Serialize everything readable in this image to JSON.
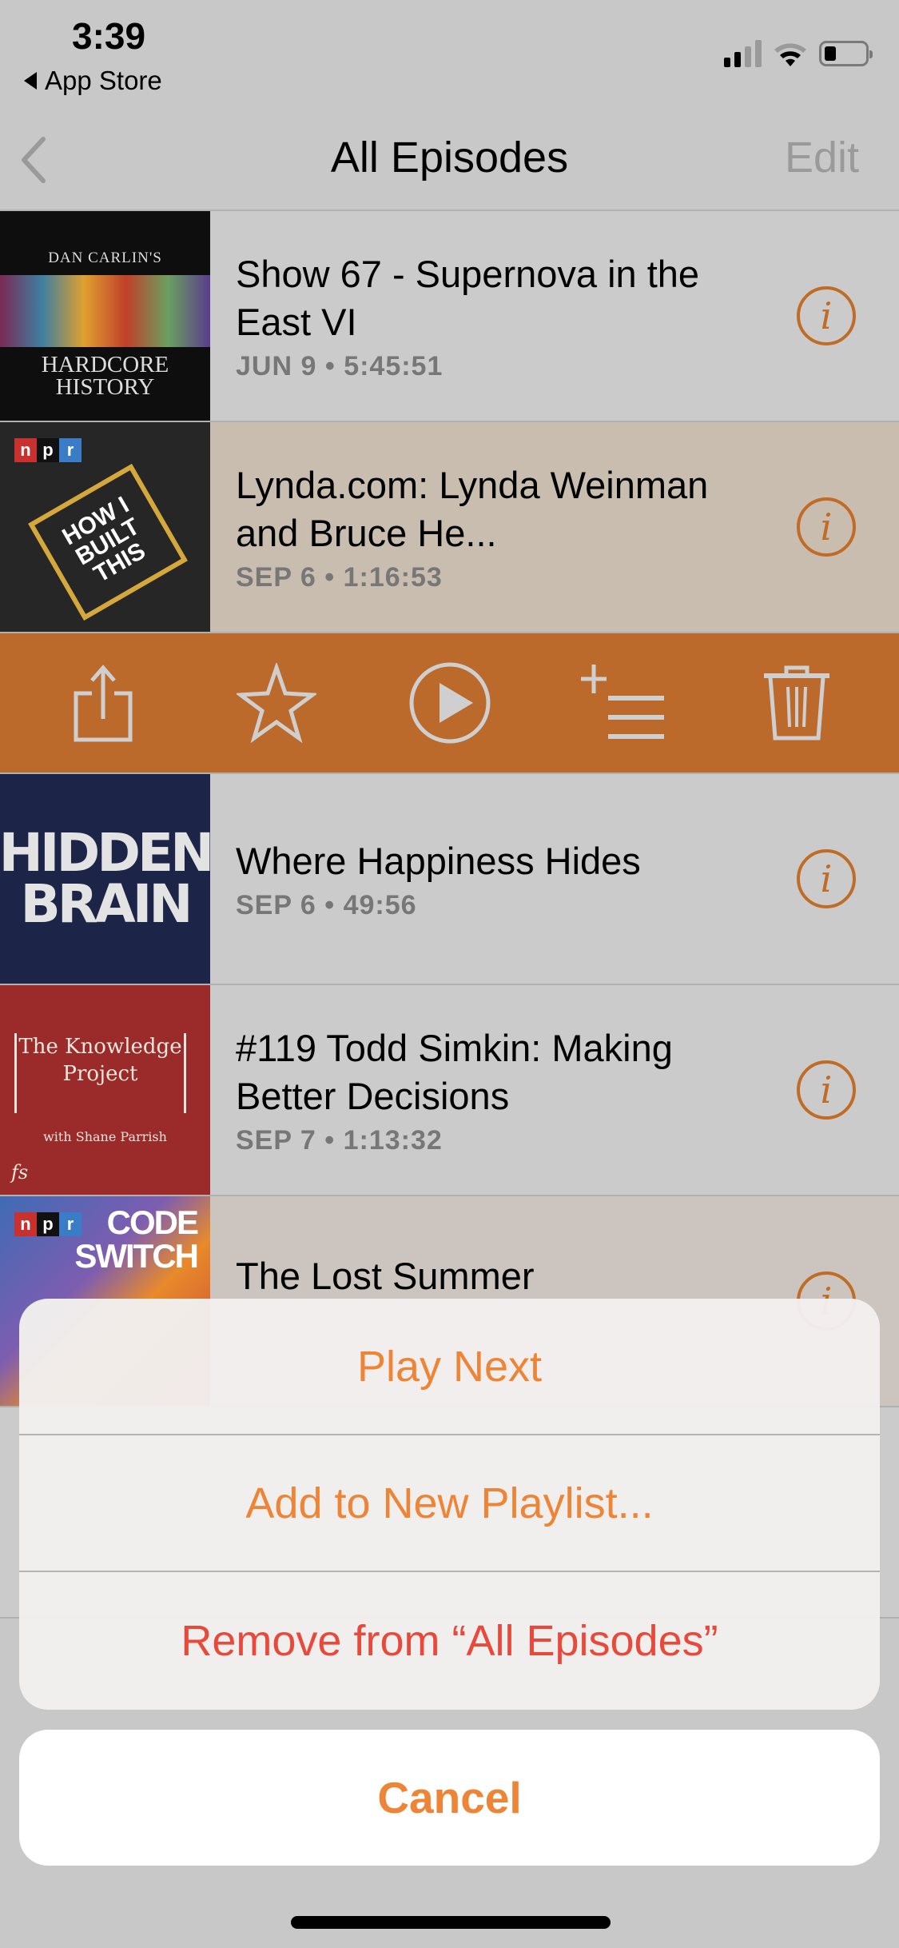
{
  "status_bar": {
    "time": "3:39",
    "back_app": "App Store",
    "signal_icon": "cellular-signal-icon",
    "wifi_icon": "wifi-icon",
    "battery_icon": "battery-icon",
    "battery_level": 0.25
  },
  "nav": {
    "back_icon": "chevron-left-icon",
    "title": "All Episodes",
    "edit_label": "Edit"
  },
  "episodes": [
    {
      "podcast": "Dan Carlin's Hardcore History",
      "art_line1": "DAN CARLIN'S",
      "art_line2": "HARDCORE HISTORY",
      "title": "Show 67 - Supernova in the East VI",
      "date": "JUN 9",
      "duration": "5:45:51"
    },
    {
      "podcast": "How I Built This with Guy Raz",
      "art_badge": "npr",
      "art_text": "HOW I BUILT THIS",
      "title": "Lynda.com: Lynda Weinman and Bruce He...",
      "date": "SEP 6",
      "duration": "1:16:53",
      "selected": true
    },
    {
      "podcast": "Hidden Brain",
      "art_line1": "HIDDEN",
      "art_line2": "BRAIN",
      "title": "Where Happiness Hides",
      "date": "SEP 6",
      "duration": "49:56"
    },
    {
      "podcast": "The Knowledge Project",
      "art_line1": "The Knowledge Project",
      "art_line2": "with Shane Parrish",
      "art_mark": "fs",
      "title": "#119 Todd Simkin: Making Better Decisions",
      "date": "SEP 7",
      "duration": "1:13:32"
    },
    {
      "podcast": "Code Switch",
      "art_badge": "npr",
      "art_text": "CODE SWITCH",
      "title": "The Lost Summer",
      "date": "",
      "duration": ""
    }
  ],
  "meta_separator": "•",
  "info_icon": "info-icon",
  "action_bar": {
    "items": [
      {
        "name": "share",
        "icon": "share-icon"
      },
      {
        "name": "favorite",
        "icon": "star-icon"
      },
      {
        "name": "play",
        "icon": "play-circle-icon"
      },
      {
        "name": "add-to-queue",
        "icon": "add-to-list-icon"
      },
      {
        "name": "delete",
        "icon": "trash-icon"
      }
    ],
    "color": "#bb6a2b"
  },
  "action_sheet": {
    "items": [
      {
        "label": "Play Next",
        "style": "default"
      },
      {
        "label": "Add to New Playlist...",
        "style": "default"
      },
      {
        "label": "Remove from “All Episodes”",
        "style": "destructive"
      }
    ],
    "cancel_label": "Cancel",
    "accent_color": "#ee8536",
    "destructive_color": "#e8493b"
  }
}
